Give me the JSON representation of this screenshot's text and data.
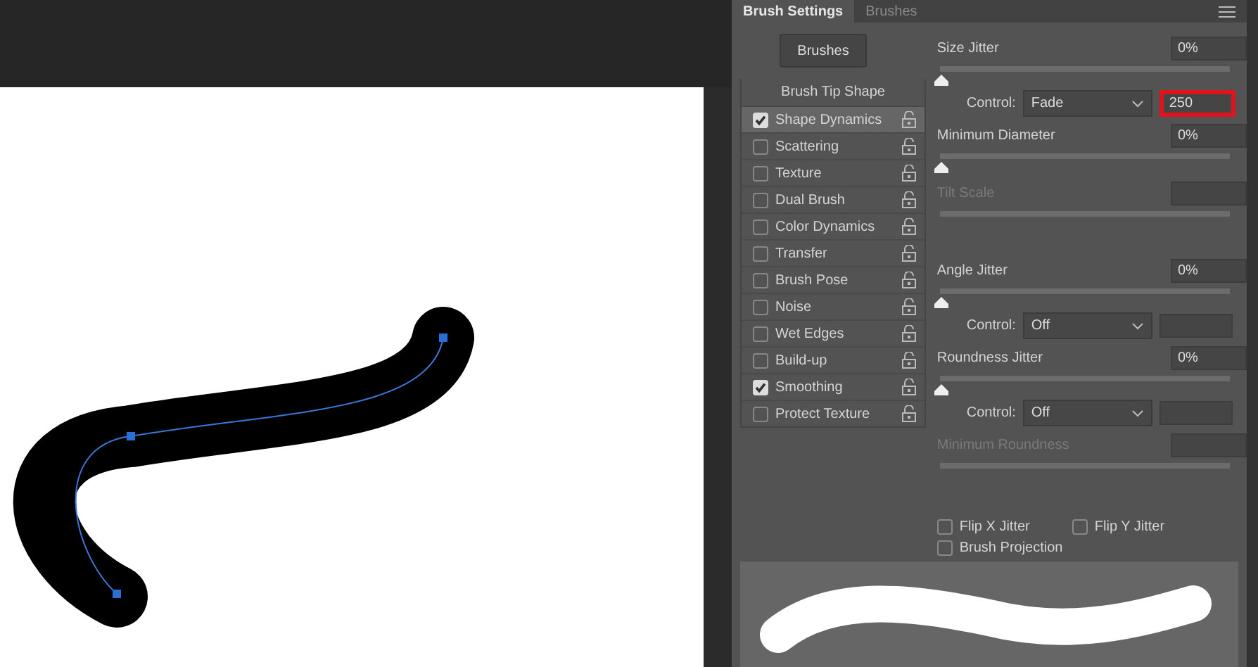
{
  "panel": {
    "tabs": [
      {
        "label": "Brush Settings",
        "selected": true
      },
      {
        "label": "Brushes",
        "selected": false
      }
    ]
  },
  "brushes_button": "Brushes",
  "brush_tip_shape": "Brush Tip Shape",
  "options": [
    {
      "label": "Shape Dynamics",
      "checked": true,
      "selected": true
    },
    {
      "label": "Scattering",
      "checked": false,
      "selected": false
    },
    {
      "label": "Texture",
      "checked": false,
      "selected": false
    },
    {
      "label": "Dual Brush",
      "checked": false,
      "selected": false
    },
    {
      "label": "Color Dynamics",
      "checked": false,
      "selected": false
    },
    {
      "label": "Transfer",
      "checked": false,
      "selected": false
    },
    {
      "label": "Brush Pose",
      "checked": false,
      "selected": false
    },
    {
      "label": "Noise",
      "checked": false,
      "selected": false
    },
    {
      "label": "Wet Edges",
      "checked": false,
      "selected": false
    },
    {
      "label": "Build-up",
      "checked": false,
      "selected": false
    },
    {
      "label": "Smoothing",
      "checked": true,
      "selected": false
    },
    {
      "label": "Protect Texture",
      "checked": false,
      "selected": false
    }
  ],
  "settings": [
    {
      "kind": "slider",
      "label": "Size Jitter",
      "value": "0%",
      "level": 0,
      "disabled": false
    },
    {
      "kind": "control",
      "label": "Control:",
      "value": "Fade",
      "amount": "250",
      "highlighted": true
    },
    {
      "kind": "slider",
      "label": "Minimum Diameter",
      "value": "0%",
      "level": 0,
      "disabled": false
    },
    {
      "kind": "slider",
      "label": "Tilt Scale",
      "disabled": true
    },
    {
      "kind": "slider",
      "label": "Angle Jitter",
      "value": "0%",
      "level": 0,
      "disabled": false
    },
    {
      "kind": "control",
      "label": "Control:",
      "value": "Off",
      "highlighted": false
    },
    {
      "kind": "slider",
      "label": "Roundness Jitter",
      "value": "0%",
      "level": 0,
      "disabled": false
    },
    {
      "kind": "control",
      "label": "Control:",
      "value": "Off",
      "highlighted": false
    },
    {
      "kind": "slider",
      "label": "Minimum Roundness",
      "disabled": true
    }
  ],
  "flips": [
    {
      "label": "Flip X Jitter",
      "checked": false
    },
    {
      "label": "Flip Y Jitter",
      "checked": false
    },
    {
      "label": "Brush Projection",
      "checked": false
    }
  ]
}
